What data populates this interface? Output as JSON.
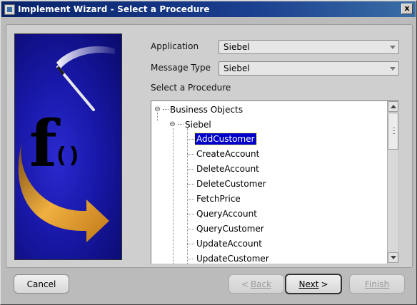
{
  "window": {
    "title": "Implement Wizard - Select a Procedure",
    "close_glyph": "x"
  },
  "graphic": {
    "letter": "f",
    "parens": "()"
  },
  "form": {
    "application_label": "Application",
    "application_value": "Siebel",
    "message_type_label": "Message Type",
    "message_type_value": "Siebel",
    "procedure_label": "Select a Procedure"
  },
  "tree": {
    "root": "Business Objects",
    "group": "Siebel",
    "collapse_glyph": "⊖",
    "selected_index": 0,
    "procedures": [
      "AddCustomer",
      "CreateAccount",
      "DeleteAccount",
      "DeleteCustomer",
      "FetchPrice",
      "QueryAccount",
      "QueryCustomer",
      "UpdateAccount",
      "UpdateCustomer"
    ]
  },
  "buttons": {
    "cancel": "Cancel",
    "back": "Back",
    "back_glyph": "<",
    "next": "Next",
    "next_glyph": ">",
    "finish": "Finish"
  }
}
